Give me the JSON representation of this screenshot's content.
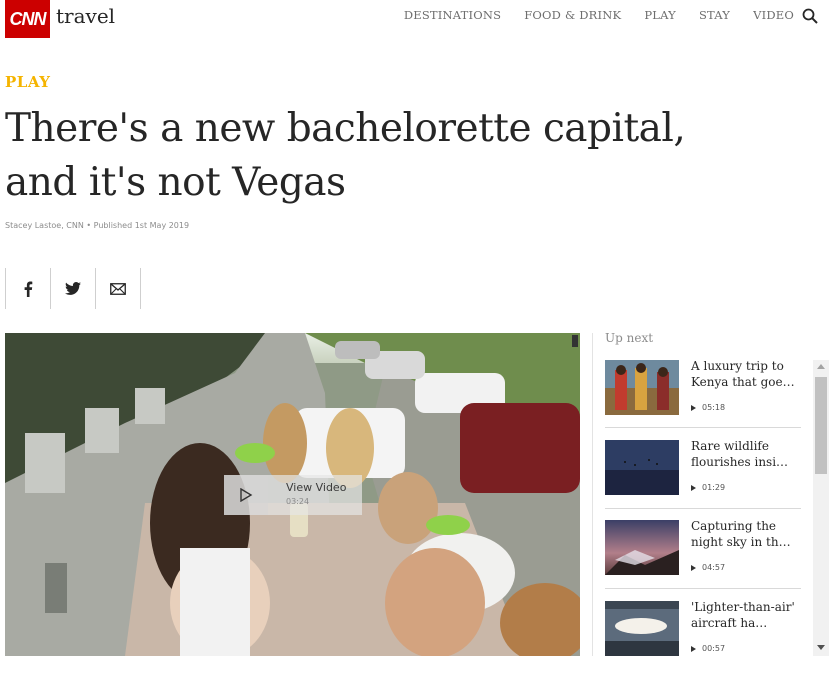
{
  "header": {
    "logo_text": "CNN",
    "brand": "travel",
    "nav": [
      "DESTINATIONS",
      "FOOD & DRINK",
      "PLAY",
      "STAY",
      "VIDEO"
    ]
  },
  "article": {
    "section": "PLAY",
    "headline_line1": "There's a new bachelorette capital,",
    "headline_line2": "and it's not Vegas",
    "byline": "Stacey Lastoe, CNN • Published 1st May 2019"
  },
  "video": {
    "label": "View Video",
    "duration": "03:24"
  },
  "upnext": {
    "title": "Up next",
    "items": [
      {
        "title": "A luxury trip to Kenya that goe…",
        "duration": "05:18"
      },
      {
        "title": "Rare wildlife flourishes insi…",
        "duration": "01:29"
      },
      {
        "title": "Capturing the night sky in th…",
        "duration": "04:57"
      },
      {
        "title": "'Lighter-than-air' aircraft ha…",
        "duration": "00:57"
      }
    ]
  },
  "colors": {
    "cnn_red": "#cc0000",
    "section_yellow": "#f5b400"
  }
}
